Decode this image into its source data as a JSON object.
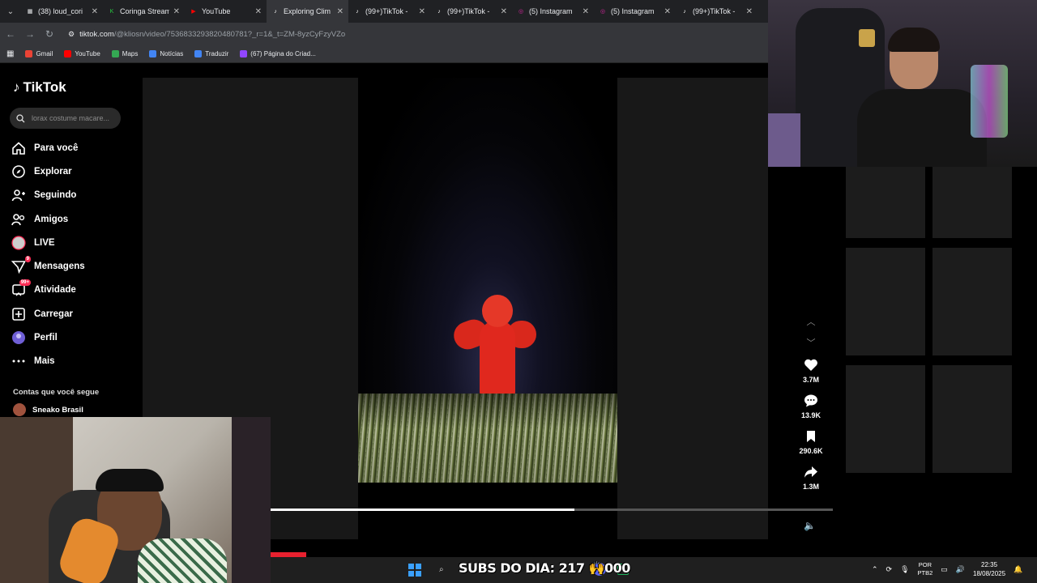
{
  "browser": {
    "tabs": [
      {
        "label": "(38) loud_cori",
        "fav_color": "#e8eaed",
        "fav": "▦",
        "active": false
      },
      {
        "label": "Coringa Stream",
        "fav_color": "#27c93f",
        "fav": "K",
        "active": false
      },
      {
        "label": "YouTube",
        "fav_color": "#ff0000",
        "fav": "▶",
        "active": false
      },
      {
        "label": "Exploring Clim",
        "fav_color": "#202124",
        "fav": "♪",
        "active": true
      },
      {
        "label": "(99+)TikTok -",
        "fav_color": "#202124",
        "fav": "♪",
        "active": false
      },
      {
        "label": "(99+)TikTok -",
        "fav_color": "#202124",
        "fav": "♪",
        "active": false
      },
      {
        "label": "(5) Instagram",
        "fav_color": "#d6249f",
        "fav": "◎",
        "active": false
      },
      {
        "label": "(5) Instagram",
        "fav_color": "#d6249f",
        "fav": "◎",
        "active": false
      },
      {
        "label": "(99+)TikTok -",
        "fav_color": "#202124",
        "fav": "♪",
        "active": false
      }
    ],
    "url_host": "tiktok.com",
    "url_rest": "/@kliosn/video/7536833293820480781?_r=1&_t=ZM-8yzCyFzyVZo",
    "bookmarks": [
      {
        "label": "Gmail",
        "color": "#ea4335"
      },
      {
        "label": "YouTube",
        "color": "#ff0000"
      },
      {
        "label": "Maps",
        "color": "#34a853"
      },
      {
        "label": "Notícias",
        "color": "#4285f4"
      },
      {
        "label": "Traduzir",
        "color": "#4285f4"
      },
      {
        "label": "(67) Página do Criad...",
        "color": "#9146ff"
      }
    ]
  },
  "tiktok": {
    "logo": "TikTok",
    "search_placeholder": "lorax costume macare...",
    "nav": [
      {
        "label": "Para você",
        "icon": "home-icon",
        "badge": ""
      },
      {
        "label": "Explorar",
        "icon": "compass-icon",
        "badge": ""
      },
      {
        "label": "Seguindo",
        "icon": "following-icon",
        "badge": ""
      },
      {
        "label": "Amigos",
        "icon": "friends-icon",
        "badge": ""
      },
      {
        "label": "LIVE",
        "icon": "live-icon",
        "badge": ""
      },
      {
        "label": "Mensagens",
        "icon": "messages-icon",
        "badge": "9"
      },
      {
        "label": "Atividade",
        "icon": "activity-icon",
        "badge": "99+"
      },
      {
        "label": "Carregar",
        "icon": "upload-icon",
        "badge": ""
      },
      {
        "label": "Perfil",
        "icon": "profile-icon",
        "badge": ""
      },
      {
        "label": "Mais",
        "icon": "more-icon",
        "badge": ""
      }
    ],
    "following_title": "Contas que você segue",
    "following_accounts": [
      {
        "name": "Sneako Brasil"
      }
    ],
    "actions": {
      "likes": "3.7M",
      "comments": "13.9K",
      "saves": "290.6K",
      "shares": "1.3M"
    },
    "progress": 0.54
  },
  "overlay": {
    "subs_text": "SUBS DO DIA: 217 🙌000"
  },
  "taskbar": {
    "lang_line1": "POR",
    "lang_line2": "PTB2",
    "time": "22:35",
    "date": "18/08/2025"
  },
  "colors": {
    "accent": "#fe2c55",
    "bg": "#000000",
    "panel": "#181818"
  }
}
